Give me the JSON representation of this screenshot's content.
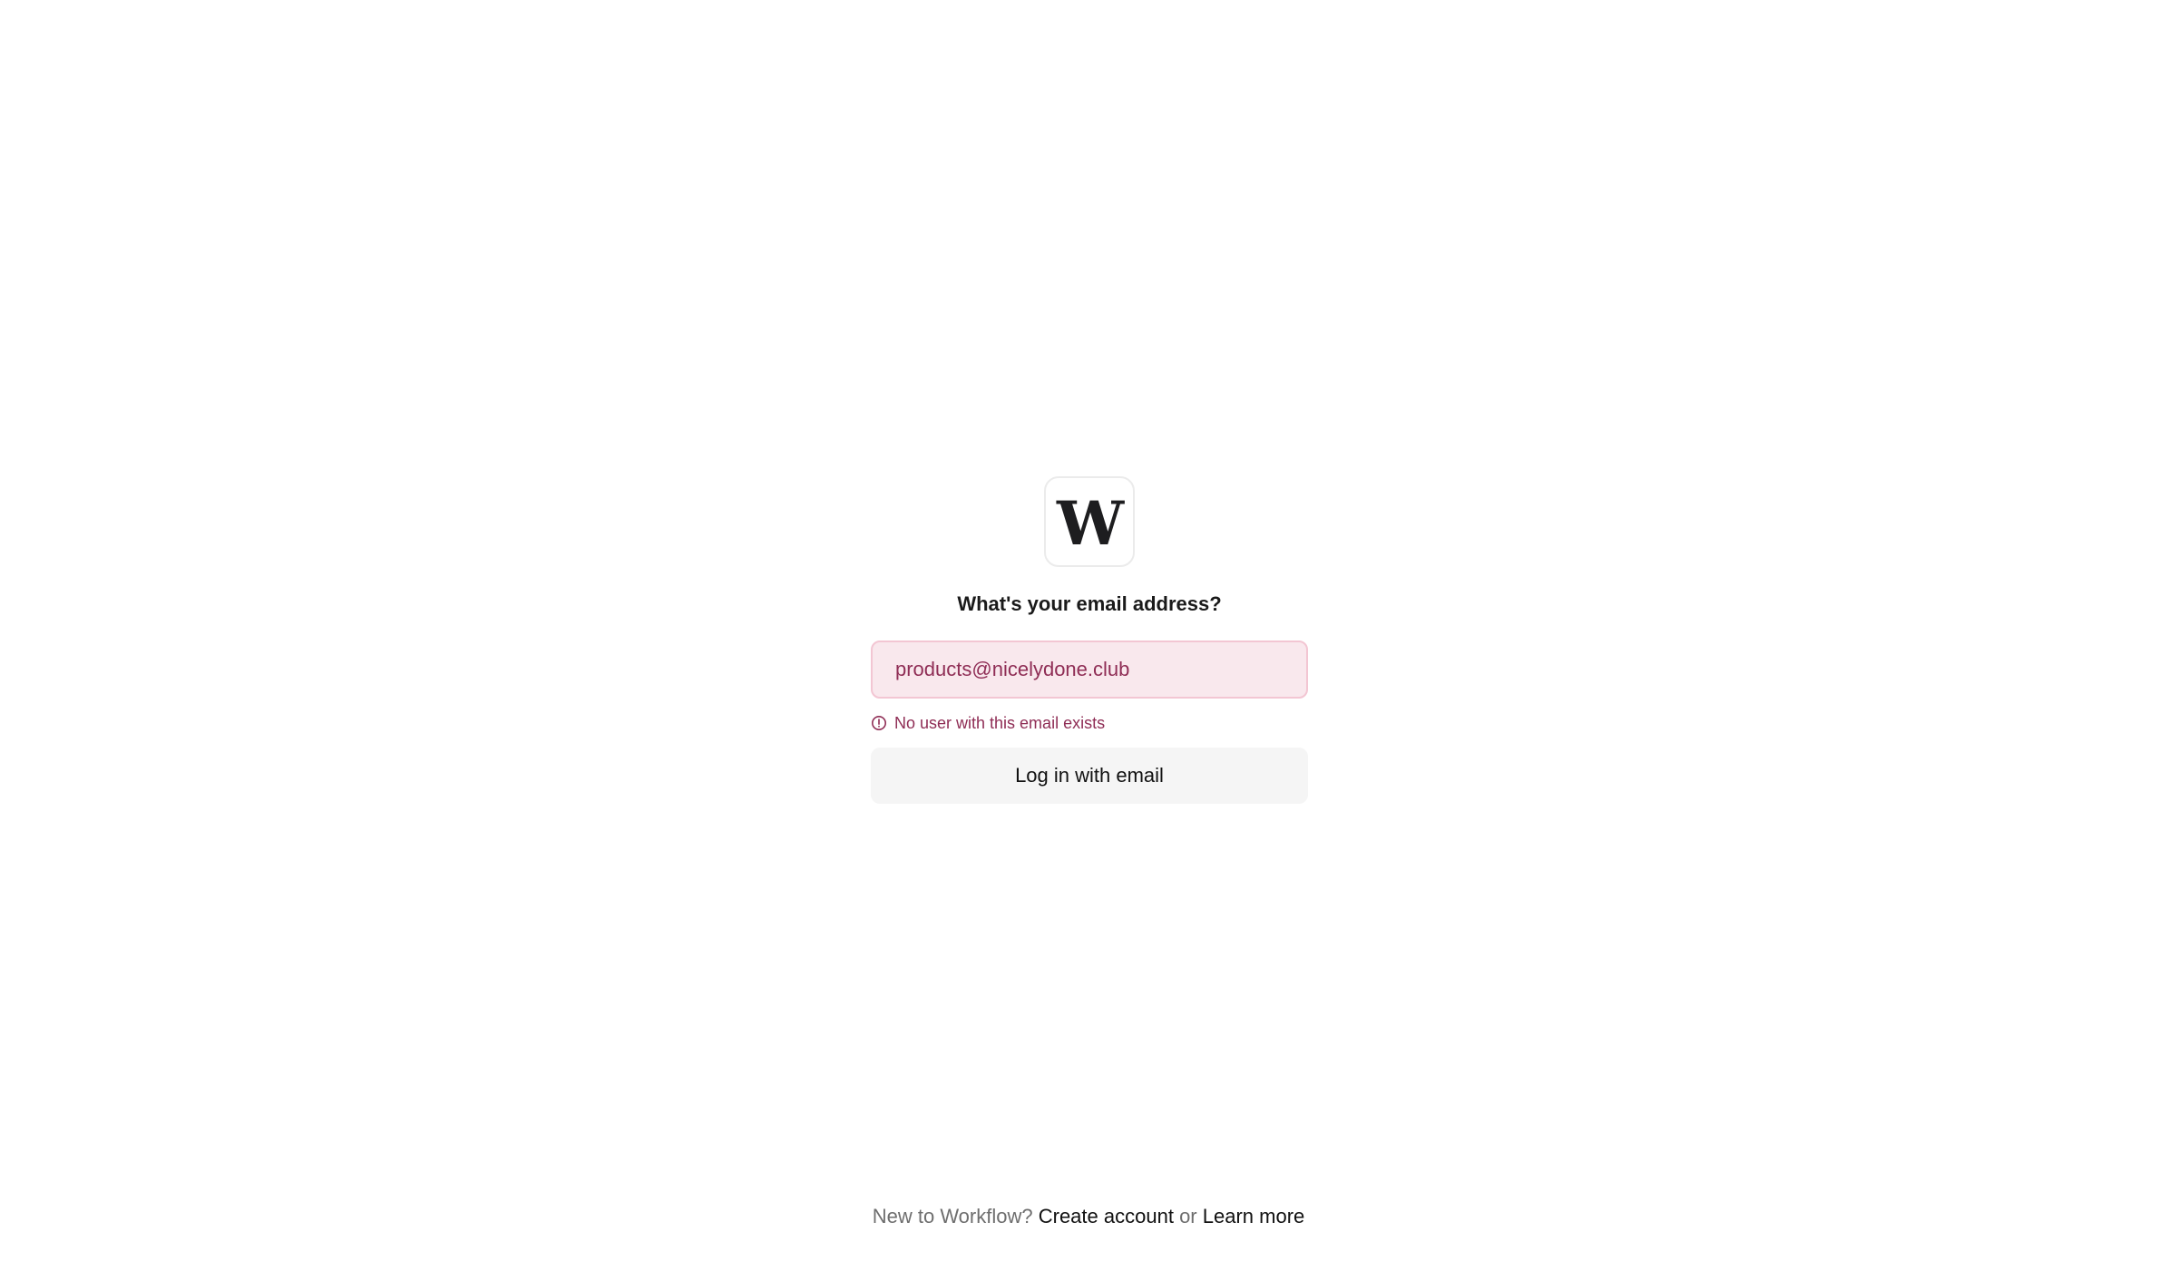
{
  "logo": {
    "letter": "W"
  },
  "login": {
    "title": "What's your email address?",
    "email_value": "products@nicelydone.club",
    "error_message": "No user with this email exists",
    "submit_label": "Log in with email"
  },
  "footer": {
    "prompt": "New to Workflow?",
    "create_account": "Create account",
    "separator": "or",
    "learn_more": "Learn more"
  },
  "colors": {
    "error": "#8f2d55",
    "error_background": "#f9e8ed",
    "button_background": "#f5f5f5"
  },
  "icons": {
    "error": "alert-circle-icon"
  }
}
